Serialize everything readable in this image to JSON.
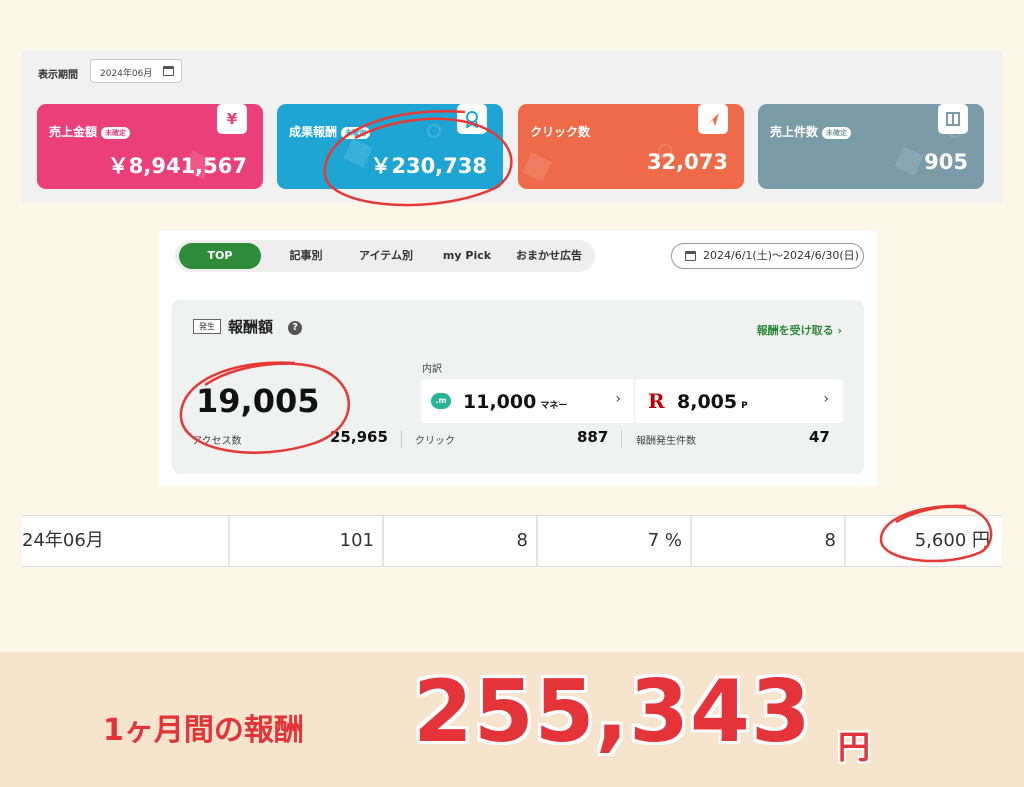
{
  "dashboard": {
    "period_label": "表示期間",
    "period_value": "2024年06月",
    "cards": [
      {
        "title": "売上金額",
        "badge": "未確定",
        "value": "￥8,941,567",
        "icon": "yen-icon"
      },
      {
        "title": "成果報酬",
        "badge": "未確定",
        "value": "￥230,738",
        "icon": "ribbon-icon"
      },
      {
        "title": "クリック数",
        "badge": "",
        "value": "32,073",
        "icon": "cursor-icon"
      },
      {
        "title": "売上件数",
        "badge": "未確定",
        "value": "905",
        "icon": "cart-icon"
      }
    ],
    "card_colors": [
      "#ea3f78",
      "#1ea5d4",
      "#ee6a49",
      "#7a9ba7"
    ]
  },
  "report": {
    "tabs": [
      "TOP",
      "記事別",
      "アイテム別",
      "my Pick",
      "おまかせ広告"
    ],
    "active_tab": "TOP",
    "date_range": "2024/6/1(土)〜2024/6/30(日)",
    "occur_badge": "発生",
    "reward_title": "報酬額",
    "receive_link": "報酬を受け取る",
    "amount": "19,005",
    "breakdown_label": "内訳",
    "money_value": "11,000",
    "money_unit": "マネー",
    "point_value": "8,005",
    "point_unit": "P",
    "stats": {
      "access_label": "アクセス数",
      "access_value": "25,965",
      "click_label": "クリック",
      "click_value": "887",
      "count_label": "報酬発生件数",
      "count_value": "47"
    },
    "accent_color": "#2e8b3a"
  },
  "table_row": {
    "cells": [
      "24年06月",
      "101",
      "8",
      "7 %",
      "8",
      "5,600 円"
    ]
  },
  "summary": {
    "label": "1ヶ月間の報酬",
    "value": "255,343",
    "unit": "円",
    "color": "#e5333a"
  }
}
